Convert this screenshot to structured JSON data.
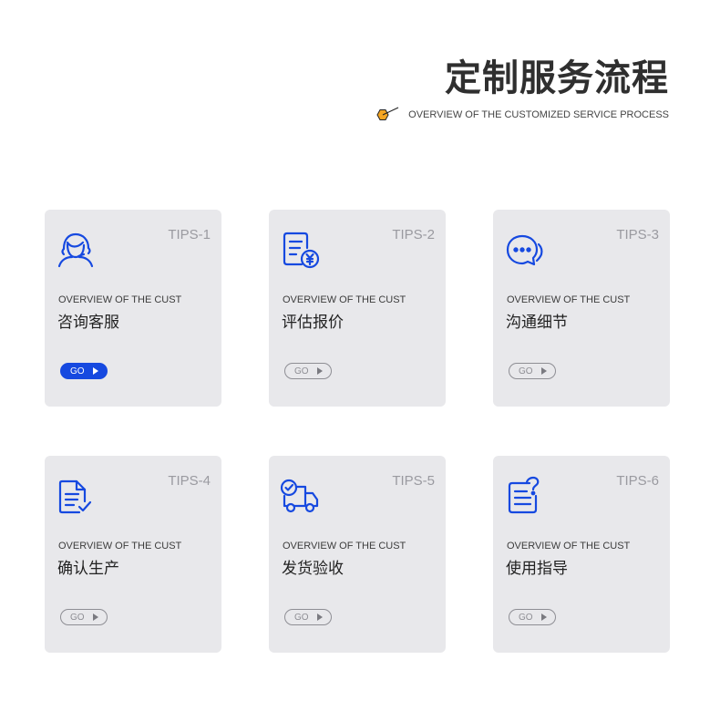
{
  "header": {
    "title": "定制服务流程",
    "subtitle": "OVERVIEW OF THE CUSTOMIZED SERVICE PROCESS"
  },
  "colors": {
    "accent_blue": "#1649e0",
    "accent_orange": "#f5a623",
    "card_bg": "#e8e8eb"
  },
  "cards": [
    {
      "tips": "TIPS-1",
      "icon": "customer-service-icon",
      "en": "OVERVIEW OF THE CUST",
      "zh": "咨询客服",
      "go": "GO",
      "active": true
    },
    {
      "tips": "TIPS-2",
      "icon": "quote-document-icon",
      "en": "OVERVIEW OF THE CUST",
      "zh": "评估报价",
      "go": "GO",
      "active": false
    },
    {
      "tips": "TIPS-3",
      "icon": "chat-bubble-icon",
      "en": "OVERVIEW OF THE CUST",
      "zh": "沟通细节",
      "go": "GO",
      "active": false
    },
    {
      "tips": "TIPS-4",
      "icon": "document-check-icon",
      "en": "OVERVIEW OF THE CUST",
      "zh": "确认生产",
      "go": "GO",
      "active": false
    },
    {
      "tips": "TIPS-5",
      "icon": "delivery-truck-icon",
      "en": "OVERVIEW OF THE CUST",
      "zh": "发货验收",
      "go": "GO",
      "active": false
    },
    {
      "tips": "TIPS-6",
      "icon": "guide-question-icon",
      "en": "OVERVIEW OF THE CUST",
      "zh": "使用指导",
      "go": "GO",
      "active": false
    }
  ]
}
